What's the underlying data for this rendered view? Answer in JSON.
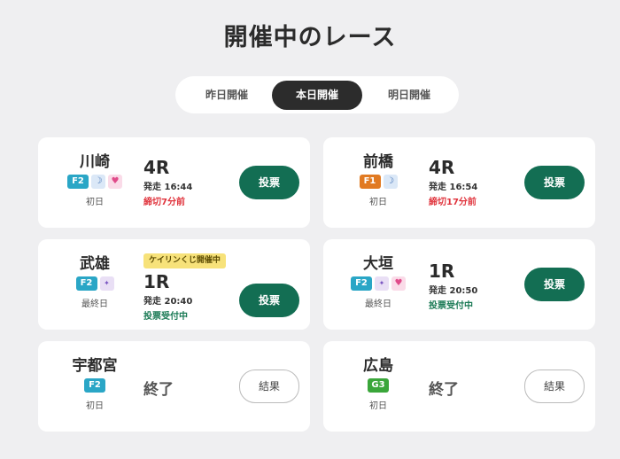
{
  "page": {
    "title": "開催中のレース"
  },
  "tabs": [
    {
      "label": "昨日開催",
      "active": false
    },
    {
      "label": "本日開催",
      "active": true
    },
    {
      "label": "明日開催",
      "active": false
    }
  ],
  "colors": {
    "F2": "#2aa6c6",
    "F1": "#e17a22",
    "G3": "#3aa63a",
    "vote_button": "#136e53",
    "deadline": "#e0333c",
    "status": "#1a7a55"
  },
  "cards": [
    {
      "venue": "川崎",
      "grade": "F2",
      "badges": [
        "night-icon",
        "heart-icon"
      ],
      "day": "初日",
      "race_no": "4R",
      "start": "発走 16:44",
      "deadline": "締切7分前",
      "button": "投票"
    },
    {
      "venue": "前橋",
      "grade": "F1",
      "badges": [
        "night-icon"
      ],
      "day": "初日",
      "race_no": "4R",
      "start": "発走 16:54",
      "deadline": "締切17分前",
      "button": "投票"
    },
    {
      "venue": "武雄",
      "grade": "F2",
      "badges": [
        "star-icon"
      ],
      "day": "最終日",
      "lottery": "ケイリンくじ開催中",
      "race_no": "1R",
      "start": "発走 20:40",
      "status": "投票受付中",
      "button": "投票"
    },
    {
      "venue": "大垣",
      "grade": "F2",
      "badges": [
        "star-icon",
        "heart-icon"
      ],
      "day": "最終日",
      "race_no": "1R",
      "start": "発走 20:50",
      "status": "投票受付中",
      "button": "投票"
    },
    {
      "venue": "宇都宮",
      "grade": "F2",
      "badges": [],
      "day": "初日",
      "result": "終了",
      "button": "結果"
    },
    {
      "venue": "広島",
      "grade": "G3",
      "badges": [],
      "day": "初日",
      "result": "終了",
      "button": "結果"
    }
  ]
}
